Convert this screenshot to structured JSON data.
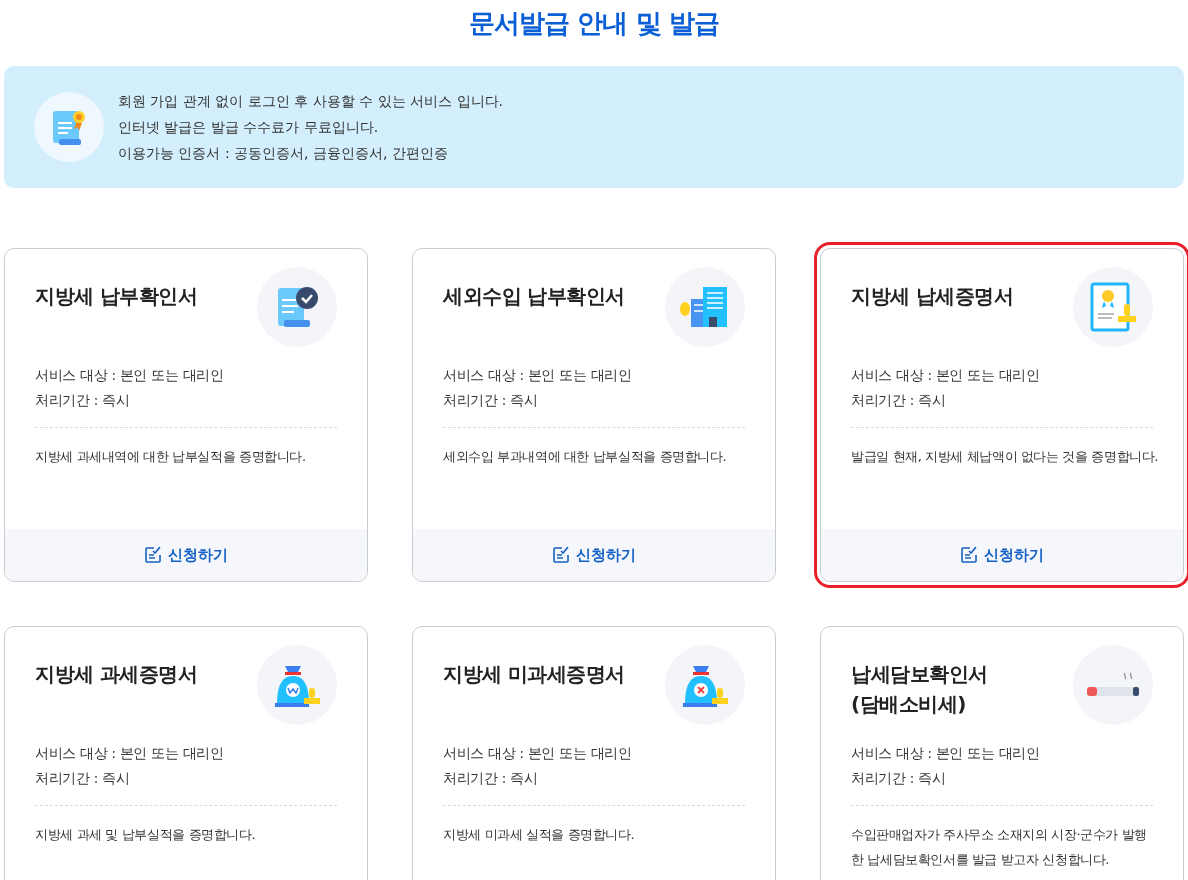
{
  "page_title": "문서발급 안내 및 발급",
  "notice": {
    "lines": [
      "회원 가입 관계 없이 로그인 후 사용할 수 있는 서비스 입니다.",
      "인터넷 발급은 발급 수수료가 무료입니다.",
      "이용가능 인증서 : 공동인증서, 금융인증서, 간편인증"
    ]
  },
  "cards": [
    {
      "kind": "scroll-check",
      "title": "지방세 납부확인서",
      "target": "서비스 대상 : 본인 또는 대리인",
      "period": "처리기간 : 즉시",
      "description": "지방세 과세내역에 대한 납부실적을 증명합니다.",
      "apply": "신청하기",
      "highlighted": false
    },
    {
      "kind": "building",
      "title": "세외수입 납부확인서",
      "target": "서비스 대상 : 본인 또는 대리인",
      "period": "처리기간 : 즉시",
      "description": "세외수입 부과내역에 대한 납부실적을 증명합니다.",
      "apply": "신청하기",
      "highlighted": false
    },
    {
      "kind": "certificate",
      "title": "지방세 납세증명서",
      "target": "서비스 대상 : 본인 또는 대리인",
      "period": "처리기간 : 즉시",
      "description": "발급일 현재, 지방세 체납액이 없다는 것을 증명합니다.",
      "apply": "신청하기",
      "highlighted": true
    },
    {
      "kind": "bag-won",
      "title": "지방세 과세증명서",
      "target": "서비스 대상 : 본인 또는 대리인",
      "period": "처리기간 : 즉시",
      "description": "지방세 과세 및 납부실적을 증명합니다.",
      "highlighted": false
    },
    {
      "kind": "bag-x",
      "title": "지방세 미과세증명서",
      "target": "서비스 대상 : 본인 또는 대리인",
      "period": "처리기간 : 즉시",
      "description": "지방세 미과세 실적을 증명합니다.",
      "highlighted": false
    },
    {
      "kind": "cigarette",
      "title": "납세담보확인서\n(담배소비세)",
      "target": "서비스 대상 : 본인 또는 대리인",
      "period": "처리기간 : 즉시",
      "description": "수입판매업자가 주사무소 소재지의 시장·군수가 발행한 납세담보확인서를 발급 받고자 신청합니다.",
      "highlighted": false
    }
  ]
}
